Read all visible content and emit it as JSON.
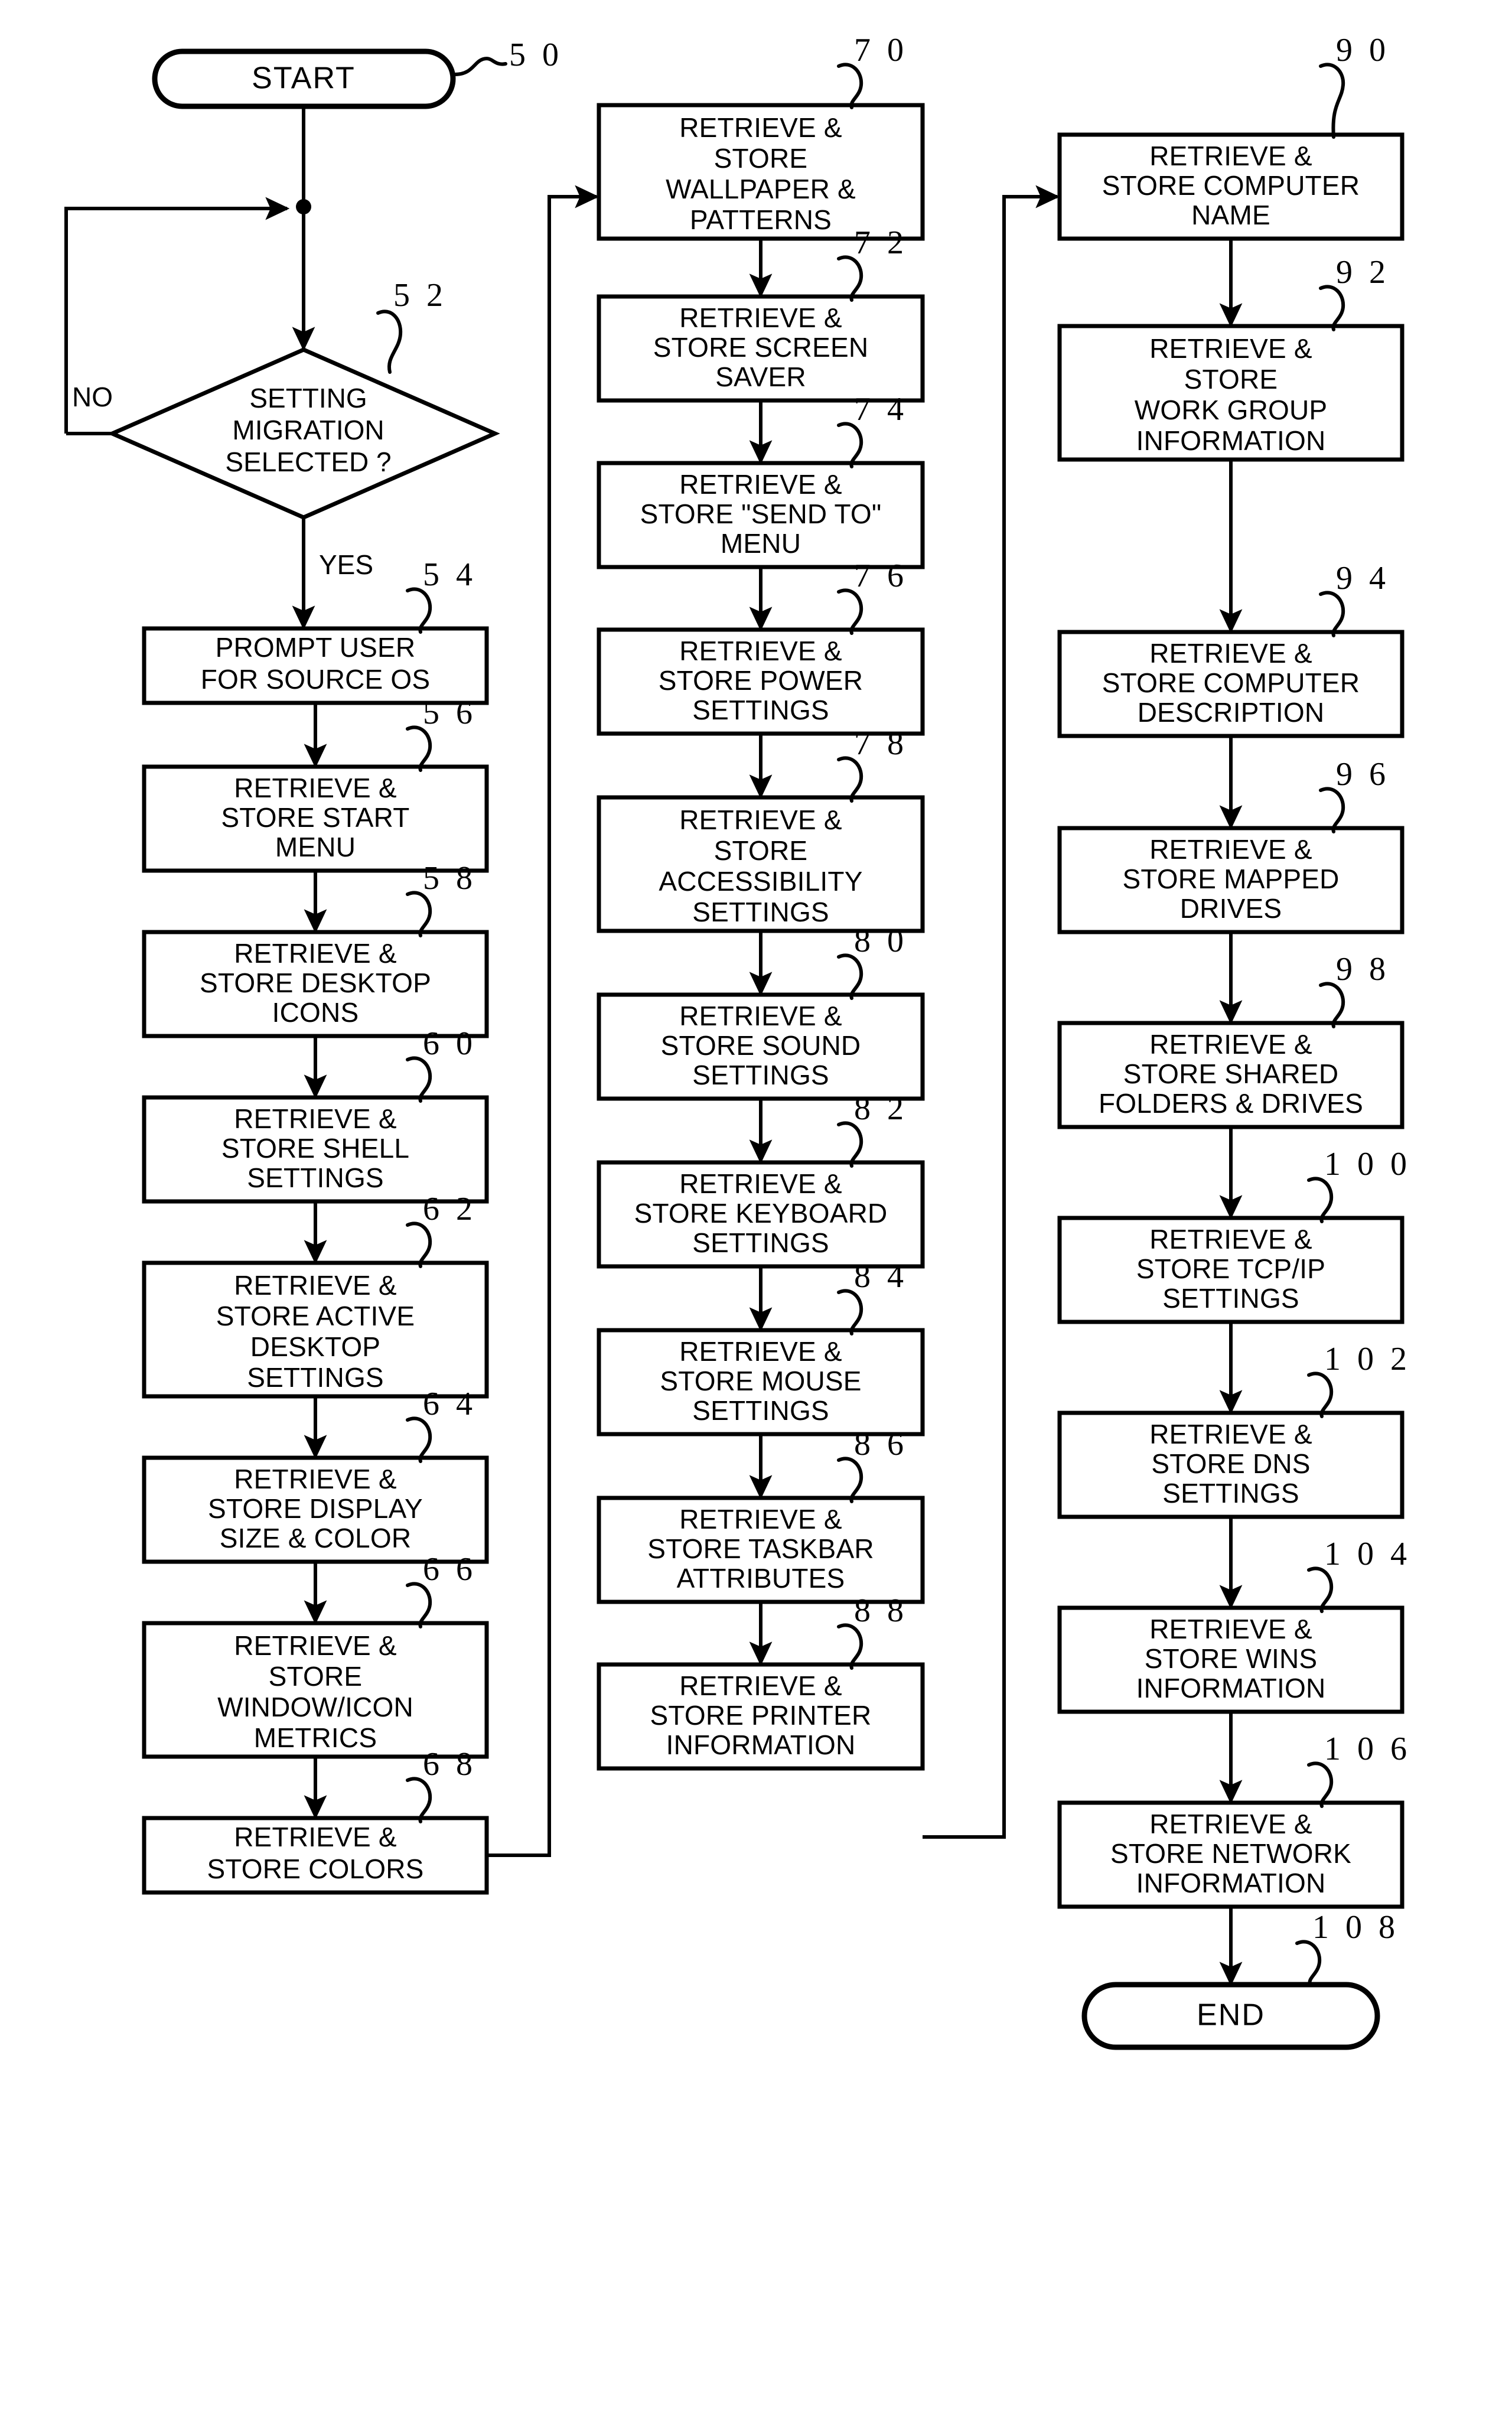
{
  "figure": {
    "type": "patent-flowchart",
    "orientation": "three-column",
    "background_color": "#ffffff",
    "line_color": "#000000"
  },
  "terminators": {
    "start": {
      "label": "START",
      "ref": "5 0"
    },
    "end": {
      "label": "END",
      "ref": "1 0 8"
    }
  },
  "decision": {
    "ref": "5 2",
    "lines": [
      "SETTING",
      "MIGRATION",
      "SELECTED ?"
    ],
    "no_label": "NO",
    "yes_label": "YES"
  },
  "columns": [
    {
      "name": "left-column",
      "steps": [
        {
          "ref": "5 4",
          "lines": [
            "PROMPT USER",
            "FOR SOURCE OS"
          ]
        },
        {
          "ref": "5 6",
          "lines": [
            "RETRIEVE &",
            "STORE START",
            "MENU"
          ]
        },
        {
          "ref": "5 8",
          "lines": [
            "RETRIEVE &",
            "STORE DESKTOP",
            "ICONS"
          ]
        },
        {
          "ref": "6 0",
          "lines": [
            "RETRIEVE &",
            "STORE SHELL",
            "SETTINGS"
          ]
        },
        {
          "ref": "6 2",
          "lines": [
            "RETRIEVE &",
            "STORE ACTIVE",
            "DESKTOP",
            "SETTINGS"
          ]
        },
        {
          "ref": "6 4",
          "lines": [
            "RETRIEVE &",
            "STORE DISPLAY",
            "SIZE & COLOR"
          ]
        },
        {
          "ref": "6 6",
          "lines": [
            "RETRIEVE &",
            "STORE",
            "WINDOW/ICON",
            "METRICS"
          ]
        },
        {
          "ref": "6 8",
          "lines": [
            "RETRIEVE &",
            "STORE COLORS"
          ]
        }
      ]
    },
    {
      "name": "middle-column",
      "steps": [
        {
          "ref": "7 0",
          "lines": [
            "RETRIEVE &",
            "STORE",
            "WALLPAPER &",
            "PATTERNS"
          ]
        },
        {
          "ref": "7 2",
          "lines": [
            "RETRIEVE &",
            "STORE SCREEN",
            "SAVER"
          ]
        },
        {
          "ref": "7 4",
          "lines": [
            "RETRIEVE &",
            "STORE \"SEND TO\"",
            "MENU"
          ]
        },
        {
          "ref": "7 6",
          "lines": [
            "RETRIEVE &",
            "STORE POWER",
            "SETTINGS"
          ]
        },
        {
          "ref": "7 8",
          "lines": [
            "RETRIEVE &",
            "STORE",
            "ACCESSIBILITY",
            "SETTINGS"
          ]
        },
        {
          "ref": "8 0",
          "lines": [
            "RETRIEVE &",
            "STORE SOUND",
            "SETTINGS"
          ]
        },
        {
          "ref": "8 2",
          "lines": [
            "RETRIEVE &",
            "STORE KEYBOARD",
            "SETTINGS"
          ]
        },
        {
          "ref": "8 4",
          "lines": [
            "RETRIEVE &",
            "STORE MOUSE",
            "SETTINGS"
          ]
        },
        {
          "ref": "8 6",
          "lines": [
            "RETRIEVE &",
            "STORE TASKBAR",
            "ATTRIBUTES"
          ]
        },
        {
          "ref": "8 8",
          "lines": [
            "RETRIEVE &",
            "STORE PRINTER",
            "INFORMATION"
          ]
        }
      ]
    },
    {
      "name": "right-column",
      "steps": [
        {
          "ref": "9 0",
          "lines": [
            "RETRIEVE &",
            "STORE COMPUTER",
            "NAME"
          ]
        },
        {
          "ref": "9 2",
          "lines": [
            "RETRIEVE &",
            "STORE",
            "WORK GROUP",
            "INFORMATION"
          ]
        },
        {
          "ref": "9 4",
          "lines": [
            "RETRIEVE &",
            "STORE COMPUTER",
            "DESCRIPTION"
          ]
        },
        {
          "ref": "9 6",
          "lines": [
            "RETRIEVE &",
            "STORE MAPPED",
            "DRIVES"
          ]
        },
        {
          "ref": "9 8",
          "lines": [
            "RETRIEVE &",
            "STORE SHARED",
            "FOLDERS & DRIVES"
          ]
        },
        {
          "ref": "1 0 0",
          "lines": [
            "RETRIEVE &",
            "STORE TCP/IP",
            "SETTINGS"
          ]
        },
        {
          "ref": "1 0 2",
          "lines": [
            "RETRIEVE &",
            "STORE DNS",
            "SETTINGS"
          ]
        },
        {
          "ref": "1 0 4",
          "lines": [
            "RETRIEVE &",
            "STORE WINS",
            "INFORMATION"
          ]
        },
        {
          "ref": "1 0 6",
          "lines": [
            "RETRIEVE &",
            "STORE NETWORK",
            "INFORMATION"
          ]
        }
      ]
    }
  ]
}
